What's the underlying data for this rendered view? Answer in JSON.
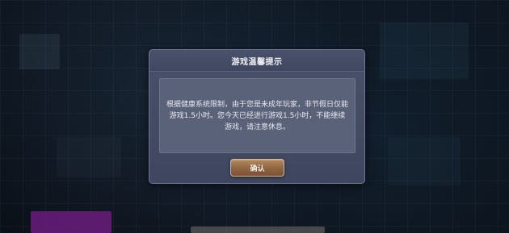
{
  "dialog": {
    "title": "游戏温馨提示",
    "message": "根据健康系统限制，由于您是未成年玩家，非节假日仅能游戏1.5小时。您今天已经进行游戏1.5小时，不能继续游戏，请注意休息。",
    "confirm_label": "确认"
  },
  "colors": {
    "dialog_bg": "#444c65",
    "message_bg": "#5a6279",
    "button_gold": "#9a6e48"
  }
}
